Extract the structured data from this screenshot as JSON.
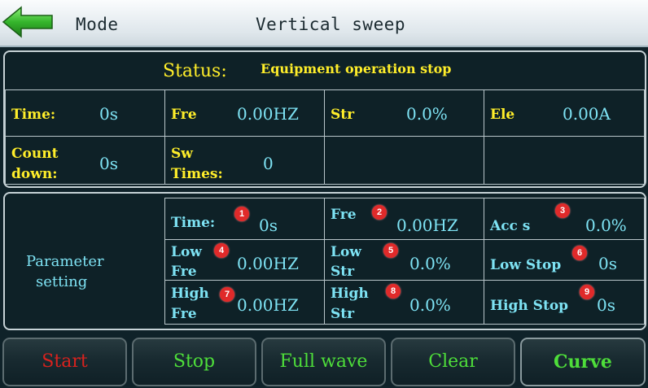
{
  "header": {
    "back_icon": "back-arrow-icon",
    "mode_label": "Mode",
    "title": "Vertical sweep"
  },
  "status": {
    "label": "Status:",
    "text": "Equipment operation stop",
    "time_label": "Time:",
    "time_value": "0s",
    "fre_label": "Fre",
    "fre_value": "0.00HZ",
    "str_label": "Str",
    "str_value": "0.0%",
    "ele_label": "Ele",
    "ele_value": "0.00A",
    "countdown_label_1": "Count",
    "countdown_label_2": "down:",
    "countdown_value": "0s",
    "sw_label_1": "Sw",
    "sw_label_2": "Times:",
    "sw_value": "0"
  },
  "params": {
    "label_1": "Parameter",
    "label_2": "setting",
    "time_label": "Time:",
    "time_badge": "1",
    "time_value": "0s",
    "fre_label": "Fre",
    "fre_badge": "2",
    "fre_value": "0.00HZ",
    "acc_label": "Acc s",
    "acc_badge": "3",
    "acc_value": "0.0%",
    "low_fre_label_1": "Low",
    "low_fre_label_2": "Fre",
    "low_fre_badge": "4",
    "low_fre_value": "0.00HZ",
    "low_str_label_1": "Low",
    "low_str_label_2": "Str",
    "low_str_badge": "5",
    "low_str_value": "0.0%",
    "low_stop_label": "Low Stop",
    "low_stop_badge": "6",
    "low_stop_value": "0s",
    "high_fre_label_1": "High",
    "high_fre_label_2": "Fre",
    "high_fre_badge": "7",
    "high_fre_value": "0.00HZ",
    "high_str_label_1": "High",
    "high_str_label_2": "Str",
    "high_str_badge": "8",
    "high_str_value": "0.0%",
    "high_stop_label": "High Stop",
    "high_stop_badge": "9",
    "high_stop_value": "0s"
  },
  "buttons": {
    "start": "Start",
    "stop": "Stop",
    "full_wave": "Full wave",
    "clear": "Clear",
    "curve": "Curve"
  },
  "colors": {
    "background": "#0f2229",
    "label_yellow": "#ffee2a",
    "value_cyan": "#7ee3f4",
    "start_red": "#d8221e",
    "button_green": "#4ede3a",
    "badge_red": "#e02a2a"
  }
}
